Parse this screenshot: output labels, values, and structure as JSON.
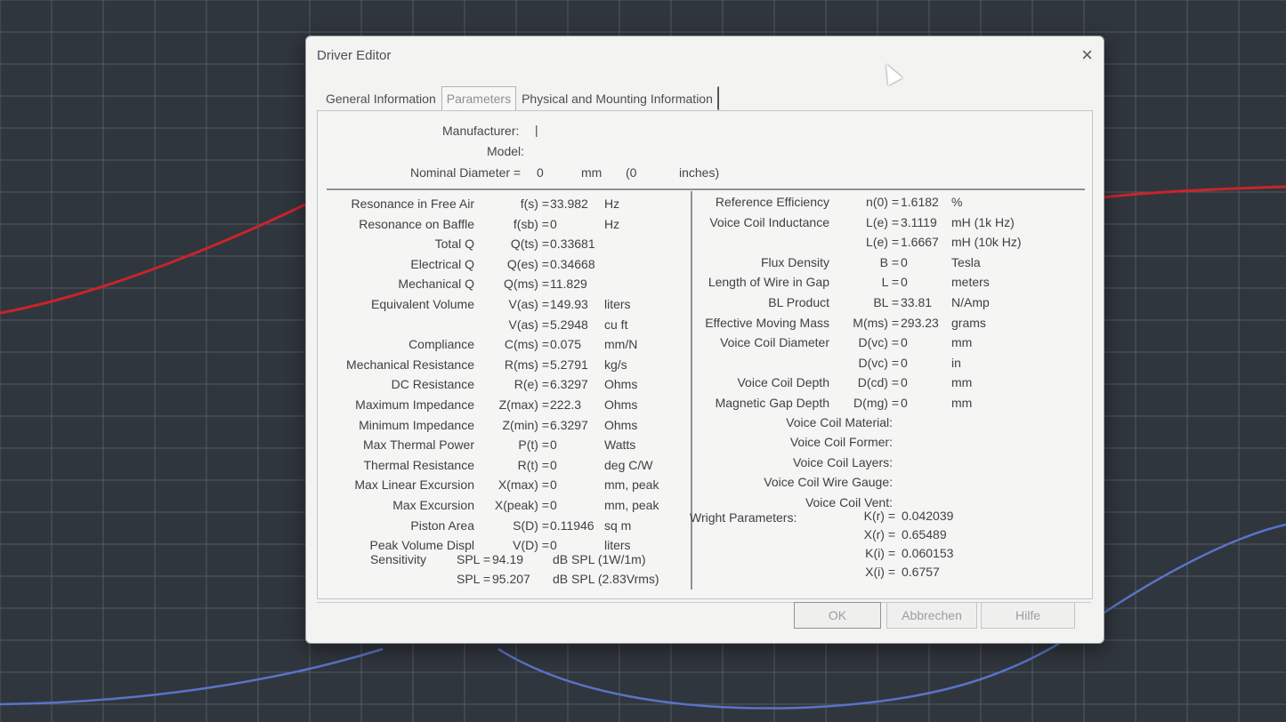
{
  "window": {
    "title": "Driver Editor",
    "close_glyph": "×"
  },
  "tabs": [
    {
      "label": "General Information"
    },
    {
      "label": "Parameters"
    },
    {
      "label": "Physical and Mounting Information"
    }
  ],
  "header": {
    "manufacturer_label": "Manufacturer:",
    "manufacturer_value": "|",
    "model_label": "Model:",
    "nominal_label": "Nominal Diameter =",
    "nominal_mm_value": "0",
    "nominal_mm_unit": "mm",
    "nominal_in_value": "(0",
    "nominal_in_unit": "inches)"
  },
  "left_params": [
    {
      "label": "Resonance in Free Air",
      "sym": "f(s) =",
      "val": "33.982",
      "unit": "Hz"
    },
    {
      "label": "Resonance on Baffle",
      "sym": "f(sb) =",
      "val": "0",
      "unit": "Hz"
    },
    {
      "label": "Total Q",
      "sym": "Q(ts) =",
      "val": "0.33681",
      "unit": ""
    },
    {
      "label": "Electrical Q",
      "sym": "Q(es) =",
      "val": "0.34668",
      "unit": ""
    },
    {
      "label": "Mechanical Q",
      "sym": "Q(ms) =",
      "val": "11.829",
      "unit": ""
    },
    {
      "label": "Equivalent Volume",
      "sym": "V(as) =",
      "val": "149.93",
      "unit": "liters"
    },
    {
      "label": "",
      "sym": "V(as) =",
      "val": "5.2948",
      "unit": "cu ft"
    },
    {
      "label": "Compliance",
      "sym": "C(ms) =",
      "val": "0.075",
      "unit": "mm/N"
    },
    {
      "label": "Mechanical Resistance",
      "sym": "R(ms) =",
      "val": "5.2791",
      "unit": "kg/s"
    },
    {
      "label": "DC Resistance",
      "sym": "R(e) =",
      "val": "6.3297",
      "unit": "Ohms"
    },
    {
      "label": "Maximum Impedance",
      "sym": "Z(max) =",
      "val": "222.3",
      "unit": "Ohms"
    },
    {
      "label": "Minimum Impedance",
      "sym": "Z(min) =",
      "val": "6.3297",
      "unit": "Ohms"
    },
    {
      "label": "Max Thermal Power",
      "sym": "P(t) =",
      "val": "0",
      "unit": "Watts"
    },
    {
      "label": "Thermal Resistance",
      "sym": "R(t) =",
      "val": "0",
      "unit": "deg C/W"
    },
    {
      "label": "Max Linear Excursion",
      "sym": "X(max) =",
      "val": "0",
      "unit": "mm, peak"
    },
    {
      "label": "Max Excursion",
      "sym": "X(peak) =",
      "val": "0",
      "unit": "mm, peak"
    },
    {
      "label": "Piston Area",
      "sym": "S(D) =",
      "val": "0.11946",
      "unit": "sq m"
    },
    {
      "label": "Peak Volume Displ",
      "sym": "V(D) =",
      "val": "0",
      "unit": "liters"
    }
  ],
  "sensitivity": [
    {
      "label": "Sensitivity",
      "sym": "SPL =",
      "val": "94.19",
      "unit": "dB SPL (1W/1m)"
    },
    {
      "label": "",
      "sym": "SPL =",
      "val": "95.207",
      "unit": "dB SPL (2.83Vrms)"
    }
  ],
  "right_params": [
    {
      "label": "Reference Efficiency",
      "sym": "n(0) =",
      "val": "1.6182",
      "unit": "%"
    },
    {
      "label": "Voice Coil Inductance",
      "sym": "L(e) =",
      "val": "3.1119",
      "unit": "mH (1k Hz)"
    },
    {
      "label": "",
      "sym": "L(e) =",
      "val": "1.6667",
      "unit": "mH (10k Hz)"
    },
    {
      "label": "Flux Density",
      "sym": "B =",
      "val": "0",
      "unit": "Tesla"
    },
    {
      "label": "Length of Wire in Gap",
      "sym": "L =",
      "val": "0",
      "unit": "meters"
    },
    {
      "label": "BL Product",
      "sym": "BL =",
      "val": "33.81",
      "unit": "N/Amp"
    },
    {
      "label": "Effective Moving Mass",
      "sym": "M(ms) =",
      "val": "293.23",
      "unit": "grams"
    },
    {
      "label": "Voice Coil Diameter",
      "sym": "D(vc) =",
      "val": "0",
      "unit": "mm"
    },
    {
      "label": "",
      "sym": "D(vc) =",
      "val": "0",
      "unit": "in"
    },
    {
      "label": "Voice Coil Depth",
      "sym": "D(cd) =",
      "val": "0",
      "unit": "mm"
    },
    {
      "label": "Magnetic Gap Depth",
      "sym": "D(mg) =",
      "val": "0",
      "unit": "mm"
    }
  ],
  "voice_coil_fields": [
    {
      "label": "Voice Coil Material:"
    },
    {
      "label": "Voice Coil Former:"
    },
    {
      "label": "Voice Coil Layers:"
    },
    {
      "label": "Voice Coil Wire Gauge:"
    },
    {
      "label": "Voice Coil Vent:"
    }
  ],
  "wright": {
    "label": "Wright Parameters:",
    "rows": [
      {
        "sym": "K(r) =",
        "val": "0.042039"
      },
      {
        "sym": "X(r) =",
        "val": "0.65489"
      },
      {
        "sym": "K(i) =",
        "val": "0.060153"
      },
      {
        "sym": "X(i) =",
        "val": "0.6757"
      }
    ]
  },
  "buttons": {
    "ok": "OK",
    "cancel": "Abbrechen",
    "help": "Hilfe"
  },
  "colors": {
    "plot_red": "#c8242a",
    "plot_blue": "#5a73c8"
  }
}
